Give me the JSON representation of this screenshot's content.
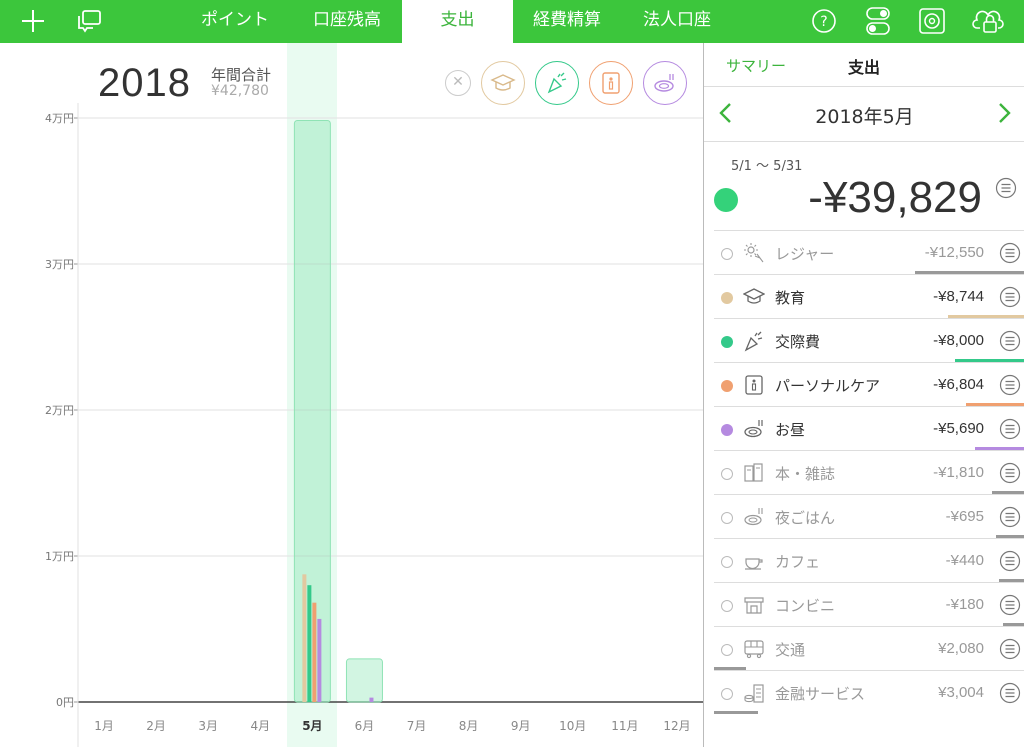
{
  "topbar": {
    "tabs": [
      {
        "label": "ポイント"
      },
      {
        "label": "口座残高"
      },
      {
        "label": "支出",
        "active": true
      },
      {
        "label": "経費精算"
      },
      {
        "label": "法人口座"
      }
    ],
    "icons": [
      "plus-icon",
      "chat-icon",
      "help-icon",
      "toggle-icon",
      "settings-icon",
      "cloud-lock-icon"
    ]
  },
  "header": {
    "year": "2018",
    "annual_label": "年間合計",
    "annual_value": "¥42,780",
    "filters": [
      "clear-filter-icon",
      "education-icon",
      "party-icon",
      "personal-care-icon",
      "lunch-icon"
    ]
  },
  "chart_data": {
    "type": "bar",
    "categories": [
      "1月",
      "2月",
      "3月",
      "4月",
      "5月",
      "6月",
      "7月",
      "8月",
      "9月",
      "10月",
      "11月",
      "12月"
    ],
    "yticks": [
      "0円",
      "1万円",
      "2万円",
      "3万円",
      "4万円"
    ],
    "ylim": [
      0,
      40000
    ],
    "selected": "5月",
    "totals": [
      0,
      0,
      0,
      0,
      39829,
      2951,
      0,
      0,
      0,
      0,
      0,
      0
    ],
    "series": [
      {
        "color": "#e2c9a0",
        "values": [
          0,
          0,
          0,
          0,
          8744,
          0,
          0,
          0,
          0,
          0,
          0,
          0
        ]
      },
      {
        "color": "#34c98a",
        "values": [
          0,
          0,
          0,
          0,
          8000,
          0,
          0,
          0,
          0,
          0,
          0,
          0
        ]
      },
      {
        "color": "#f0a070",
        "values": [
          0,
          0,
          0,
          0,
          6804,
          0,
          0,
          0,
          0,
          0,
          0,
          0
        ]
      },
      {
        "color": "#b58ae0",
        "values": [
          0,
          0,
          0,
          0,
          5690,
          300,
          0,
          0,
          0,
          0,
          0,
          0
        ]
      }
    ]
  },
  "panel": {
    "summary_label": "サマリー",
    "expense_label": "支出",
    "month": "2018年5月",
    "range": "5/1 ～ 5/31",
    "total": "-¥39,829",
    "total_color": "#34d27a",
    "categories": [
      {
        "name": "レジャー",
        "amount": "-¥12,550",
        "active": false,
        "color": "#999999",
        "icon": "leisure-icon",
        "fraction": 1.0
      },
      {
        "name": "教育",
        "amount": "-¥8,744",
        "active": true,
        "color": "#e2c9a0",
        "icon": "education-icon",
        "fraction": 0.7
      },
      {
        "name": "交際費",
        "amount": "-¥8,000",
        "active": true,
        "color": "#34c98a",
        "icon": "party-icon",
        "fraction": 0.64
      },
      {
        "name": "パーソナルケア",
        "amount": "-¥6,804",
        "active": true,
        "color": "#f0a070",
        "icon": "personal-care-icon",
        "fraction": 0.54
      },
      {
        "name": "お昼",
        "amount": "-¥5,690",
        "active": true,
        "color": "#b58ae0",
        "icon": "lunch-icon",
        "fraction": 0.45
      },
      {
        "name": "本・雑誌",
        "amount": "-¥1,810",
        "active": false,
        "color": "#999999",
        "icon": "book-icon",
        "fraction": 0.3
      },
      {
        "name": "夜ごはん",
        "amount": "-¥695",
        "active": false,
        "color": "#999999",
        "icon": "dinner-icon",
        "fraction": 0.26
      },
      {
        "name": "カフェ",
        "amount": "-¥440",
        "active": false,
        "color": "#999999",
        "icon": "cafe-icon",
        "fraction": 0.24
      },
      {
        "name": "コンビニ",
        "amount": "-¥180",
        "active": false,
        "color": "#999999",
        "icon": "convenience-store-icon",
        "fraction": 0.2
      },
      {
        "name": "交通",
        "amount": "¥2,080",
        "active": false,
        "color": "#999999",
        "icon": "bus-icon",
        "fraction": 0.29,
        "positive": true
      },
      {
        "name": "金融サービス",
        "amount": "¥3,004",
        "active": false,
        "color": "#999999",
        "icon": "finance-icon",
        "fraction": 0.4,
        "positive": true
      }
    ]
  }
}
